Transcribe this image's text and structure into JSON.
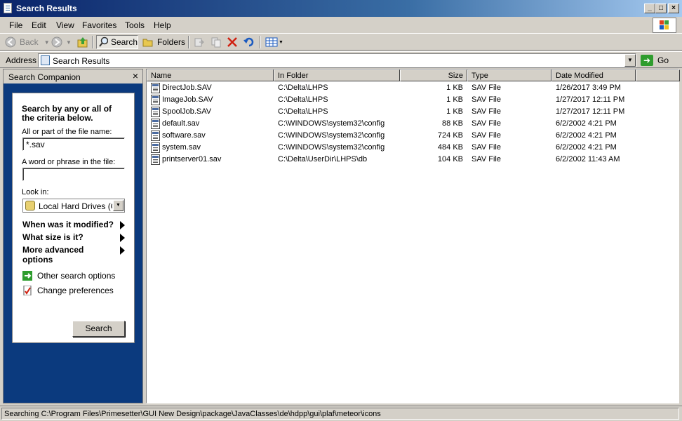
{
  "window": {
    "title": "Search Results"
  },
  "menu": [
    "File",
    "Edit",
    "View",
    "Favorites",
    "Tools",
    "Help"
  ],
  "toolbar": {
    "back": "Back",
    "search": "Search",
    "folders": "Folders"
  },
  "address": {
    "label": "Address",
    "value": "Search Results",
    "go": "Go"
  },
  "companion": {
    "title": "Search Companion",
    "close": "×",
    "heading_line1": "Search by any or all of",
    "heading_line2": "the criteria below.",
    "filename_label": "All or part of the file name:",
    "filename_value": "*.sav",
    "phrase_label": "A word or phrase in the file:",
    "phrase_value": "",
    "lookin_label": "Look in:",
    "lookin_value": "Local Hard Drives (C:;",
    "when_modified": "When was it modified?",
    "what_size": "What size is it?",
    "advanced_line1": "More advanced",
    "advanced_line2": "options",
    "other_options": "Other search options",
    "change_prefs": "Change preferences",
    "search_button": "Search"
  },
  "columns": [
    "Name",
    "In Folder",
    "Size",
    "Type",
    "Date Modified"
  ],
  "files": [
    {
      "name": "DirectJob.SAV",
      "folder": "C:\\Delta\\LHPS",
      "size": "1 KB",
      "type": "SAV File",
      "date": "1/26/2017 3:49 PM"
    },
    {
      "name": "ImageJob.SAV",
      "folder": "C:\\Delta\\LHPS",
      "size": "1 KB",
      "type": "SAV File",
      "date": "1/27/2017 12:11 PM"
    },
    {
      "name": "SpoolJob.SAV",
      "folder": "C:\\Delta\\LHPS",
      "size": "1 KB",
      "type": "SAV File",
      "date": "1/27/2017 12:11 PM"
    },
    {
      "name": "default.sav",
      "folder": "C:\\WINDOWS\\system32\\config",
      "size": "88 KB",
      "type": "SAV File",
      "date": "6/2/2002 4:21 PM"
    },
    {
      "name": "software.sav",
      "folder": "C:\\WINDOWS\\system32\\config",
      "size": "724 KB",
      "type": "SAV File",
      "date": "6/2/2002 4:21 PM"
    },
    {
      "name": "system.sav",
      "folder": "C:\\WINDOWS\\system32\\config",
      "size": "484 KB",
      "type": "SAV File",
      "date": "6/2/2002 4:21 PM"
    },
    {
      "name": "printserver01.sav",
      "folder": "C:\\Delta\\UserDir\\LHPS\\db",
      "size": "104 KB",
      "type": "SAV File",
      "date": "6/2/2002 11:43 AM"
    }
  ],
  "status": "Searching C:\\Program Files\\Primesetter\\GUI New Design\\package\\JavaClasses\\de\\hdpp\\gui\\plaf\\meteor\\icons"
}
